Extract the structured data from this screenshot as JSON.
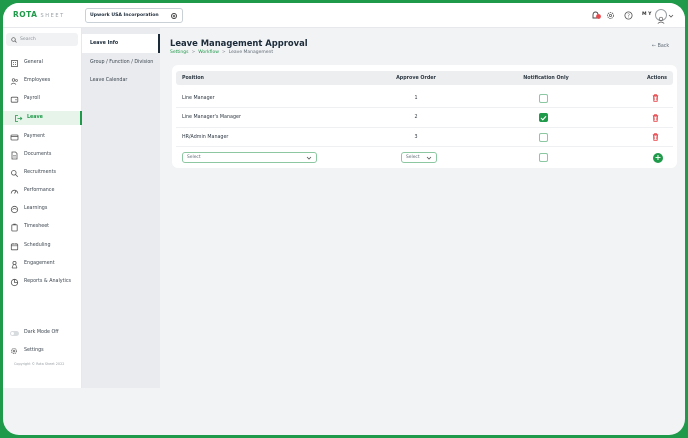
{
  "topbar": {
    "logo": "ROTA",
    "logo_sub": "SHEET",
    "company": "Upwork USA Incorporation",
    "user_initials": "M Y"
  },
  "sidebar": {
    "search_placeholder": "Search",
    "items": [
      {
        "label": "General",
        "icon": "building-icon"
      },
      {
        "label": "Employees",
        "icon": "people-icon"
      },
      {
        "label": "Payroll",
        "icon": "wallet-icon"
      },
      {
        "label": "Leave",
        "icon": "exit-icon",
        "active": true
      },
      {
        "label": "Payment",
        "icon": "card-icon"
      },
      {
        "label": "Documents",
        "icon": "document-icon"
      },
      {
        "label": "Recruitments",
        "icon": "search-user-icon"
      },
      {
        "label": "Performance",
        "icon": "gauge-icon"
      },
      {
        "label": "Learnings",
        "icon": "learning-icon"
      },
      {
        "label": "Timesheet",
        "icon": "clipboard-icon"
      },
      {
        "label": "Scheduling",
        "icon": "calendar-icon"
      },
      {
        "label": "Engagement",
        "icon": "engagement-icon"
      },
      {
        "label": "Reports & Analytics",
        "icon": "chart-icon"
      }
    ],
    "dark_mode_label": "Dark Mode Off",
    "settings_label": "Settings",
    "copyright": "Copyright © Rota Sheet 2022"
  },
  "subnav": {
    "items": [
      {
        "label": "Leave Info",
        "active": true
      },
      {
        "label": "Group / Function / Division"
      },
      {
        "label": "Leave Calendar"
      }
    ]
  },
  "main": {
    "title": "Leave Management Approval",
    "breadcrumb": [
      "Settings",
      "Workflow",
      "Leave Management"
    ],
    "back_label": "Back",
    "table": {
      "headers": [
        "Position",
        "Approve Order",
        "Notification Only",
        "Actions"
      ],
      "rows": [
        {
          "position": "Line Manager",
          "order": "1",
          "notify": false
        },
        {
          "position": "Line Manager's Manager",
          "order": "2",
          "notify": true
        },
        {
          "position": "HR/Admin Manager",
          "order": "3",
          "notify": false
        }
      ],
      "new_row": {
        "position_placeholder": "Select",
        "order_placeholder": "Select",
        "add": "+"
      }
    }
  },
  "colors": {
    "brand": "#1f9a4a",
    "danger": "#e5484d",
    "dark": "#1c2b3a"
  }
}
